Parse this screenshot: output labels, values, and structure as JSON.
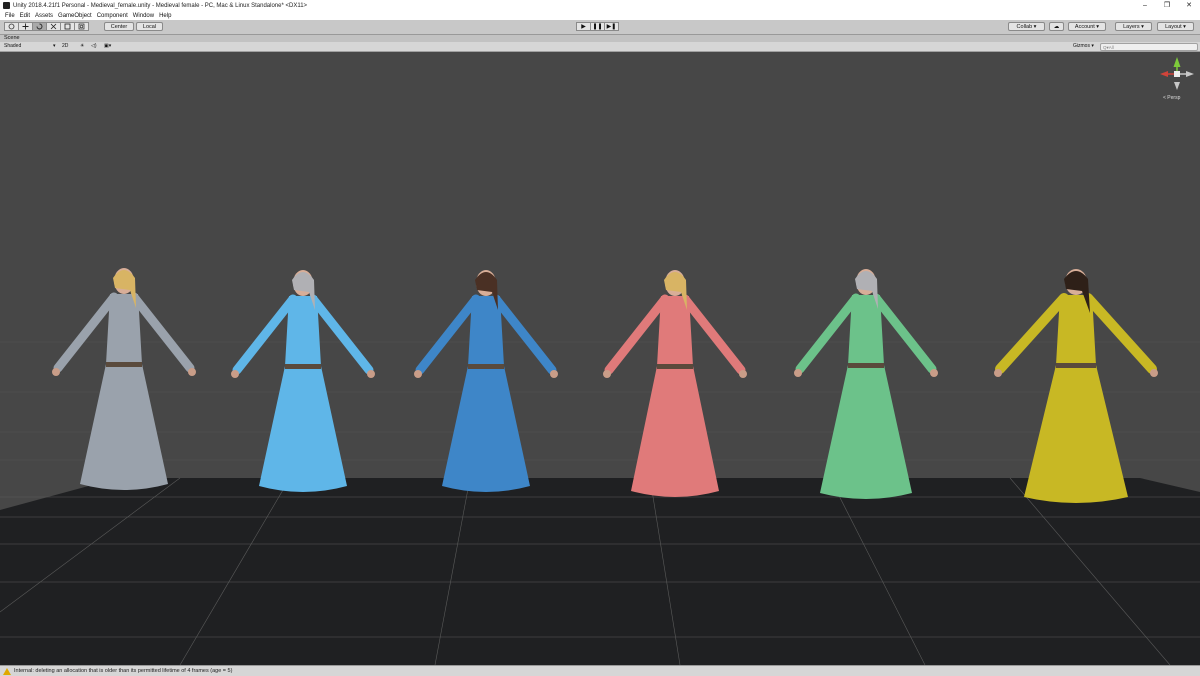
{
  "window": {
    "title": "Unity 2018.4.21f1 Personal - Medieval_female.unity - Medieval female - PC, Mac & Linux Standalone* <DX11>",
    "minimize": "–",
    "maximize": "❐",
    "close": "✕"
  },
  "menu": [
    "File",
    "Edit",
    "Assets",
    "GameObject",
    "Component",
    "Window",
    "Help"
  ],
  "toolbar": {
    "tools": [
      "hand-tool",
      "move-tool",
      "rotate-tool",
      "scale-tool",
      "rect-tool",
      "transform-tool"
    ],
    "pivot": "Center",
    "space": "Local",
    "play": "▶",
    "pause": "❚❚",
    "step": "▶❚",
    "collab": "Collab ▾",
    "cloud": "☁",
    "account": "Account ▾",
    "layers": "Layers ▾",
    "layout": "Layout ▾"
  },
  "scene": {
    "tab": "Scene",
    "shading": "Shaded",
    "mode2d": "2D",
    "gizmos": "Gizmos ▾",
    "search_placeholder": "Q▾All",
    "persp": "< Persp"
  },
  "characters": [
    {
      "hair": "blonde",
      "dress": "#9aa2ac"
    },
    {
      "hair": "silver",
      "dress": "#5fb6e8"
    },
    {
      "hair": "brown",
      "dress": "#3e86c8"
    },
    {
      "hair": "blonde",
      "dress": "#e07a7a"
    },
    {
      "hair": "silver",
      "dress": "#6cc28a"
    },
    {
      "hair": "dark-brown",
      "dress": "#c8b824"
    }
  ],
  "colors": {
    "viewport_bg": "#474747",
    "floor": "#1f2022"
  },
  "status": {
    "message": "Internal: deleting an allocation that is older than its permitted lifetime of 4 frames (age = 5)"
  }
}
